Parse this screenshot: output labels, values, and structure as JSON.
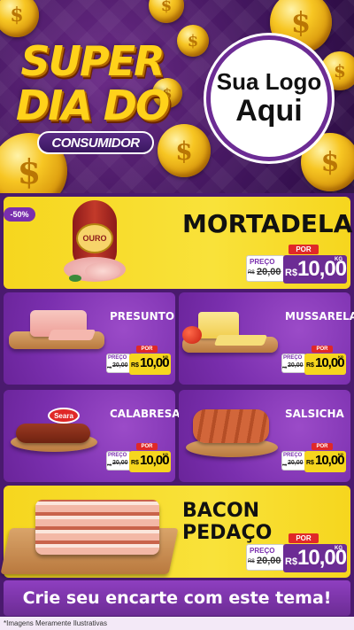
{
  "header": {
    "title_line1": "SUPER",
    "title_line2": "DIA DO",
    "subtitle": "CONSUMIDOR",
    "logo_line1": "Sua Logo",
    "logo_line2": "Aqui"
  },
  "colors": {
    "purple": "#6c2c94",
    "yellow": "#f6d61e",
    "red_tag": "#e02828",
    "gold": "#ffd21a"
  },
  "products": {
    "mortadela": {
      "name": "MORTADELA",
      "badge": "-50%",
      "brand": "OURO",
      "por": "POR",
      "preco_label": "PREÇO",
      "old_currency": "R$",
      "old_price": "20,00",
      "currency": "R$",
      "price": "10,00",
      "unit": "KG"
    },
    "presunto": {
      "name": "PRESUNTO",
      "por": "POR",
      "preco_label": "PREÇO",
      "old_currency": "R$",
      "old_price": "20,00",
      "currency": "R$",
      "price": "10,00",
      "unit": "KG"
    },
    "mussarela": {
      "name": "MUSSARELA",
      "por": "POR",
      "preco_label": "PREÇO",
      "old_currency": "R$",
      "old_price": "20,00",
      "currency": "R$",
      "price": "10,00",
      "unit": "KG"
    },
    "calabresa": {
      "name": "CALABRESA",
      "brand": "Seara",
      "por": "POR",
      "preco_label": "PREÇO",
      "old_currency": "R$",
      "old_price": "20,00",
      "currency": "R$",
      "price": "10,00",
      "unit": "KG"
    },
    "salsicha": {
      "name": "SALSICHA",
      "por": "POR",
      "preco_label": "PREÇO",
      "old_currency": "R$",
      "old_price": "20,00",
      "currency": "R$",
      "price": "10,00",
      "unit": "KG"
    },
    "bacon": {
      "name": "BACON PEDAÇO",
      "por": "POR",
      "preco_label": "PREÇO",
      "old_currency": "R$",
      "old_price": "20,00",
      "currency": "R$",
      "price": "10,00",
      "unit": "KG"
    }
  },
  "footer": {
    "banner": "Crie seu encarte com este tema!",
    "disclaimer": "*Imagens Meramente Ilustrativas"
  },
  "icons": [
    "coin-icon",
    "dollar-icon"
  ]
}
